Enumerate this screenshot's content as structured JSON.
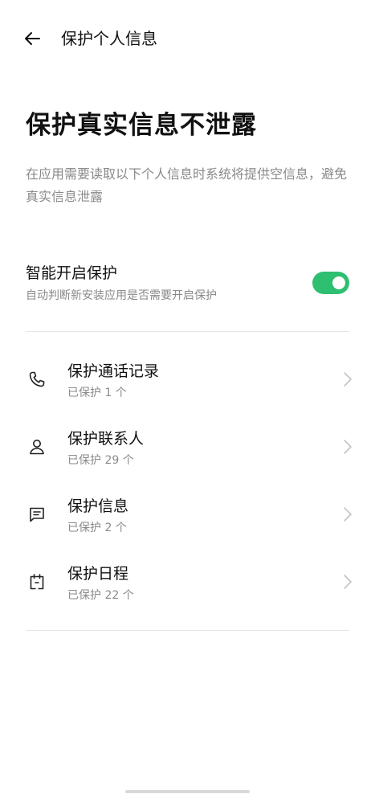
{
  "header": {
    "back_icon": "arrow-left-icon",
    "title": "保护个人信息"
  },
  "hero": {
    "title": "保护真实信息不泄露",
    "description": "在应用需要读取以下个人信息时系统将提供空信息，避免真实信息泄露"
  },
  "smart_protect": {
    "title": "智能开启保护",
    "subtitle": "自动判断新安装应用是否需要开启保护",
    "enabled": true,
    "accent_color": "#2fbf71"
  },
  "items": [
    {
      "icon": "phone-icon",
      "title": "保护通话记录",
      "subtitle": "已保护 1 个"
    },
    {
      "icon": "contact-person-icon",
      "title": "保护联系人",
      "subtitle": "已保护 29 个"
    },
    {
      "icon": "message-icon",
      "title": "保护信息",
      "subtitle": "已保护 2 个"
    },
    {
      "icon": "calendar-icon",
      "title": "保护日程",
      "subtitle": "已保护 22 个"
    }
  ]
}
